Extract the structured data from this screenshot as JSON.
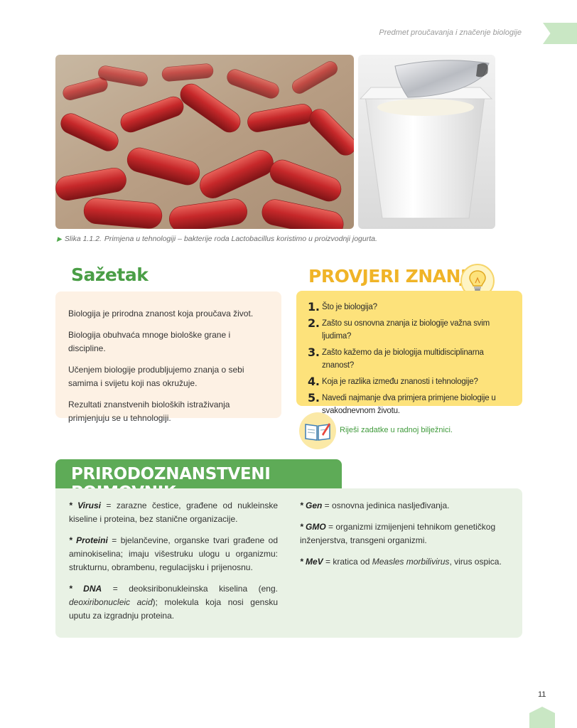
{
  "header": {
    "section_title": "Predmet proučavanja i značenje biologije"
  },
  "figure": {
    "caption_label": "Slika 1.1.2.",
    "caption_text": "Primjena u tehnologiji – bakterije roda Lactobacillus koristimo u proizvodnji jogurta."
  },
  "summary": {
    "title": "Sažetak",
    "paragraphs": [
      "Biologija je prirodna znanost koja proučava život.",
      "Biologija obuhvaća mnoge biološke grane i discipline.",
      "Učenjem biologije produbljujemo znanja o sebi samima i svijetu koji nas okružuje.",
      "Rezultati znanstvenih bioloških istraživanja primjenjuju se u tehnologiji."
    ]
  },
  "check": {
    "title": "PROVJERI ZNANJE",
    "questions": [
      {
        "num": "1.",
        "text": "Što je biologija?"
      },
      {
        "num": "2.",
        "text": "Zašto su osnovna znanja iz biologije važna svim ljudima?"
      },
      {
        "num": "3.",
        "text": "Zašto kažemo da je biologija multidisciplinarna znanost?"
      },
      {
        "num": "4.",
        "text": "Koja je razlika između znanosti i tehnologije?"
      },
      {
        "num": "5.",
        "text": "Navedi najmanje dva primjera primjene biologije u svakodnevnom životu."
      }
    ],
    "workbook": "Riješi zadatke u radnoj bilježnici."
  },
  "glossary": {
    "title": "PRIRODOZNANSTVENI POJMOVNIK",
    "left": [
      {
        "term": "* Virusi",
        "def": " = zarazne čestice, građene od nukleinske kiseline i proteina, bez stanične organizacije."
      },
      {
        "term": "* Proteini",
        "def": " = bjelančevine, organske tvari građene od aminokiselina; imaju višestruku ulogu u organizmu: strukturnu, obrambenu, regulacijsku i prijenosnu."
      },
      {
        "term": "* DNA",
        "def": " = deoksiribonukleinska kiselina (eng. ",
        "italic": "deoxiribonucleic acid",
        "def2": "); molekula koja nosi gensku uputu za izgradnju proteina."
      }
    ],
    "right": [
      {
        "term": "* Gen",
        "def": " = osnovna jedinica nasljeđivanja."
      },
      {
        "term": "* GMO",
        "def": " = organizmi izmijenjeni tehnikom genetičkog inženjerstva, transgeni organizmi."
      },
      {
        "term": "* MeV",
        "def": " = kratica od ",
        "italic": "Measles morbilivirus",
        "def2": ", virus ospica."
      }
    ]
  },
  "page_number": "11",
  "colors": {
    "green": "#5eab57",
    "yellow": "#fde27b",
    "peach": "#fdf1e4",
    "light_green": "#e9f2e5"
  }
}
